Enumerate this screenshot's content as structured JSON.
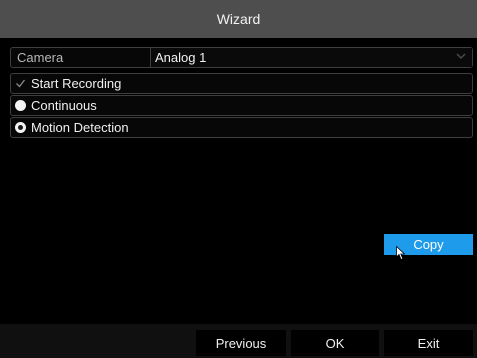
{
  "window": {
    "title": "Wizard"
  },
  "camera": {
    "label": "Camera",
    "value": "Analog 1"
  },
  "options": {
    "start_recording": {
      "label": "Start Recording",
      "checked": true
    },
    "continuous": {
      "label": "Continuous",
      "selected": false
    },
    "motion_detection": {
      "label": "Motion Detection",
      "selected": true
    }
  },
  "buttons": {
    "copy": "Copy",
    "previous": "Previous",
    "ok": "OK",
    "exit": "Exit"
  },
  "colors": {
    "accent": "#1e9bea",
    "titlebar": "#4e4e4e",
    "background": "#000000"
  },
  "icons": {
    "dropdown": "chevron-down-icon",
    "checkbox": "checkmark-icon",
    "cursor": "mouse-pointer-icon"
  }
}
